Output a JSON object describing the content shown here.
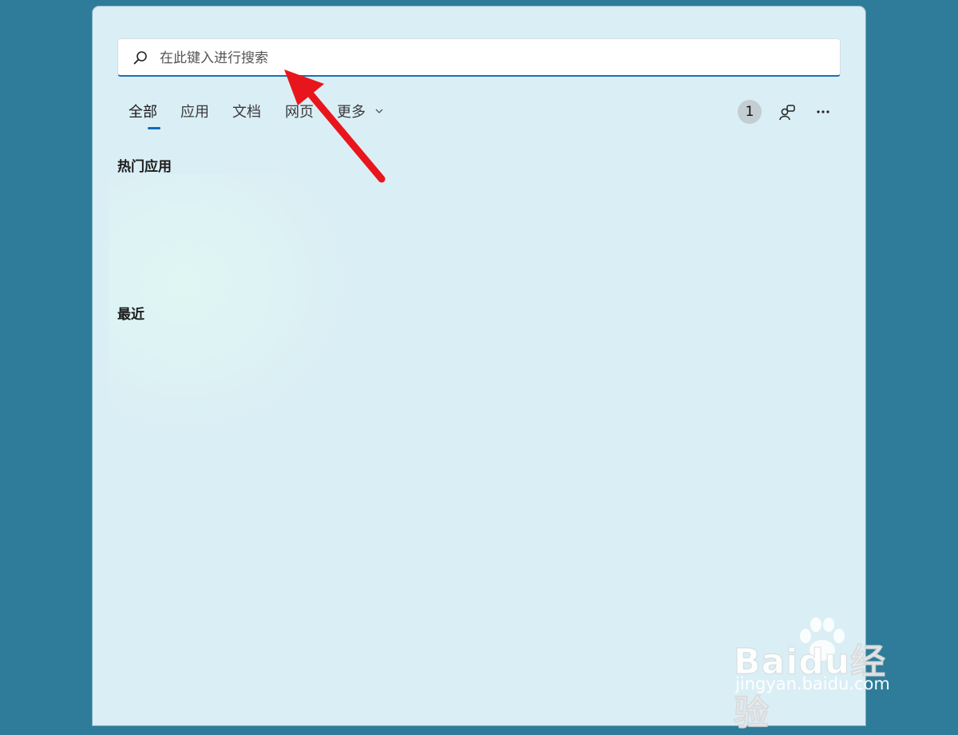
{
  "search": {
    "placeholder": "在此键入进行搜索",
    "icon": "search-icon"
  },
  "tabs": [
    {
      "label": "全部",
      "active": true
    },
    {
      "label": "应用",
      "active": false
    },
    {
      "label": "文档",
      "active": false
    },
    {
      "label": "网页",
      "active": false
    },
    {
      "label": "更多",
      "active": false,
      "has_dropdown": true
    }
  ],
  "toolbar": {
    "points_badge": "1",
    "account_icon": "account-switch-icon",
    "more_icon": "more-options-icon"
  },
  "sections": {
    "top_apps": "热门应用",
    "recent": "最近"
  },
  "watermark": {
    "brand": "Baidu经验",
    "url": "jingyan.baidu.com"
  },
  "colors": {
    "desktop": "#2e7c99",
    "panel": "#daeef5",
    "accent": "#0f6cbd",
    "annotation_arrow": "#e8161c"
  }
}
